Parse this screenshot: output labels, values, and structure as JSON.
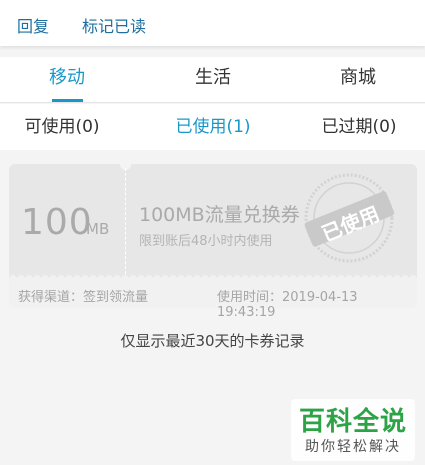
{
  "actions": {
    "reply": "回复",
    "mark_read": "标记已读"
  },
  "category_tabs": [
    {
      "label": "移动",
      "active": true
    },
    {
      "label": "生活",
      "active": false
    },
    {
      "label": "商城",
      "active": false
    }
  ],
  "status_tabs": [
    {
      "label": "可使用(0)",
      "active": false
    },
    {
      "label": "已使用(1)",
      "active": true
    },
    {
      "label": "已过期(0)",
      "active": false
    }
  ],
  "coupon": {
    "amount": "100",
    "unit": "MB",
    "title": "100MB流量兑换券",
    "subtitle": "限到账后48小时内使用",
    "stamp": "已使用",
    "channel": "获得渠道：签到领流量",
    "used_time": "使用时间：2019-04-13 19:43:19"
  },
  "notice": "仅显示最近30天的卡券记录",
  "watermark": {
    "title": "百科全说",
    "subtitle": "助你轻松解决"
  },
  "colors": {
    "accent": "#1a97c9",
    "link": "#1e6fa0",
    "watermark_green": "#2da347"
  }
}
